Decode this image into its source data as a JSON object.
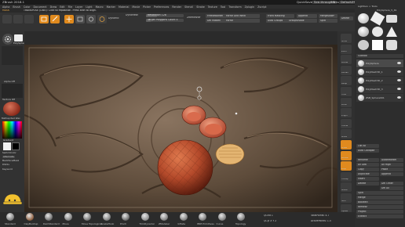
{
  "title_bar": {
    "app_title": "ZBrush 2018.1",
    "quick_save": "QuickSave",
    "see_through": "See-through 0",
    "menus": "Menus",
    "default_zscript": "DefaultZScript"
  },
  "menu_bar": [
    "Alpha",
    "Brush",
    "Color",
    "Document",
    "Draw",
    "Edit",
    "File",
    "Layer",
    "Light",
    "Macro",
    "Marker",
    "Material",
    "Movie",
    "Picker",
    "Preferences",
    "Render",
    "Stencil",
    "Stroke",
    "Texture",
    "Tool",
    "Transform",
    "Zplugin",
    "Zscript"
  ],
  "info": {
    "mask_hint": "MASK",
    "message": "TRANSPOSE (LINE): Click to reposition. Press shift to align."
  },
  "toolbar": {
    "home": "Home Page",
    "lightbox": "LightBox",
    "live_boolean": "Live Boolean",
    "edit": "Edit",
    "draw": "Draw",
    "move": "Move",
    "scale": "Scale",
    "rotate": "Rotate",
    "gizmo": "Gizmo",
    "dynamic": "Dynamic",
    "dynamesh": "DynaMesh",
    "resolution": "Resolution 128",
    "target_polygons": "Target Polygons Count 5",
    "zremesher": "ZRemesher",
    "freeze_border": "FreezeBorder",
    "mirror_and_weld": "Mirror And Weld",
    "del_hidden": "Del Hidden",
    "mirror": "Mirror",
    "front_masking": "Front Masking",
    "append": "Append",
    "auto_groups": "Auto Groups",
    "group_visible": "GroupVisible",
    "merge_down": "MergeDown",
    "split": "Split",
    "delete": "Delete"
  },
  "left_tray": {
    "polysphere_label": "PolySphere",
    "alpha_off": "Alpha Off",
    "texture_off": "Texture Off",
    "material": "MatCap Red Wax",
    "gradient": "Gradient",
    "switch_color": "SwitchColor",
    "alternate": "Alternate",
    "backface_mask": "BackfaceMask",
    "dynamic_sub": "DSDiv",
    "keyword": "Keyword"
  },
  "right_shelf": [
    "Scroll",
    "Zoom",
    "Actual",
    "AAHalf",
    "Persp",
    "Floor",
    "Local",
    "L.Sym",
    "Frame",
    "Move",
    "Scale",
    "Rotate",
    "PolyF",
    "Transp",
    "Ghost",
    "Solo",
    "Xpose"
  ],
  "right_tray": {
    "header": "Lightbox > Tools",
    "tool_name": "PolySphere_5_49",
    "subtool_header": "Subtool",
    "subtools": [
      "PolySphere",
      "PolyMesh3D_1",
      "PolyMesh3D_2",
      "PolyMesh3D_3",
      "ZSB_Sphere001"
    ],
    "list_all": "List All",
    "auto_collapse": "Auto Collapse",
    "rename": "Rename",
    "auto_reorder": "AutoReorder",
    "all_low": "All Low",
    "all_high": "All High",
    "copy": "Copy",
    "paste": "Paste",
    "duplicate": "Duplicate",
    "append": "Append",
    "insert": "Insert",
    "delete": "Delete",
    "del_other": "Del Other",
    "del_all": "Del All",
    "split": "Split",
    "merge": "Merge",
    "boolean": "Boolean",
    "remesh": "Remesh",
    "project": "Project",
    "extract": "Extract"
  },
  "bottom_bar": {
    "brushes": [
      "Standard",
      "ClayBuildup",
      "DamStandard",
      "Move",
      "Move Topological",
      "SnakeHook",
      "Pinch",
      "TrimDynamic",
      "ZModeler",
      "Inflate",
      "IMM Primitives",
      "Curve",
      "Topology"
    ],
    "qgrid": "QGrid 1",
    "qcyl": "QCyl X Y Z",
    "total_points": "TotalPoints: 4.7",
    "active_points": "ActivePoints: 1.5"
  },
  "colors": {
    "accent": "#e08a1e",
    "panel": "#333333",
    "wood": "#5b4a3a",
    "sphere": "#b9502c"
  }
}
